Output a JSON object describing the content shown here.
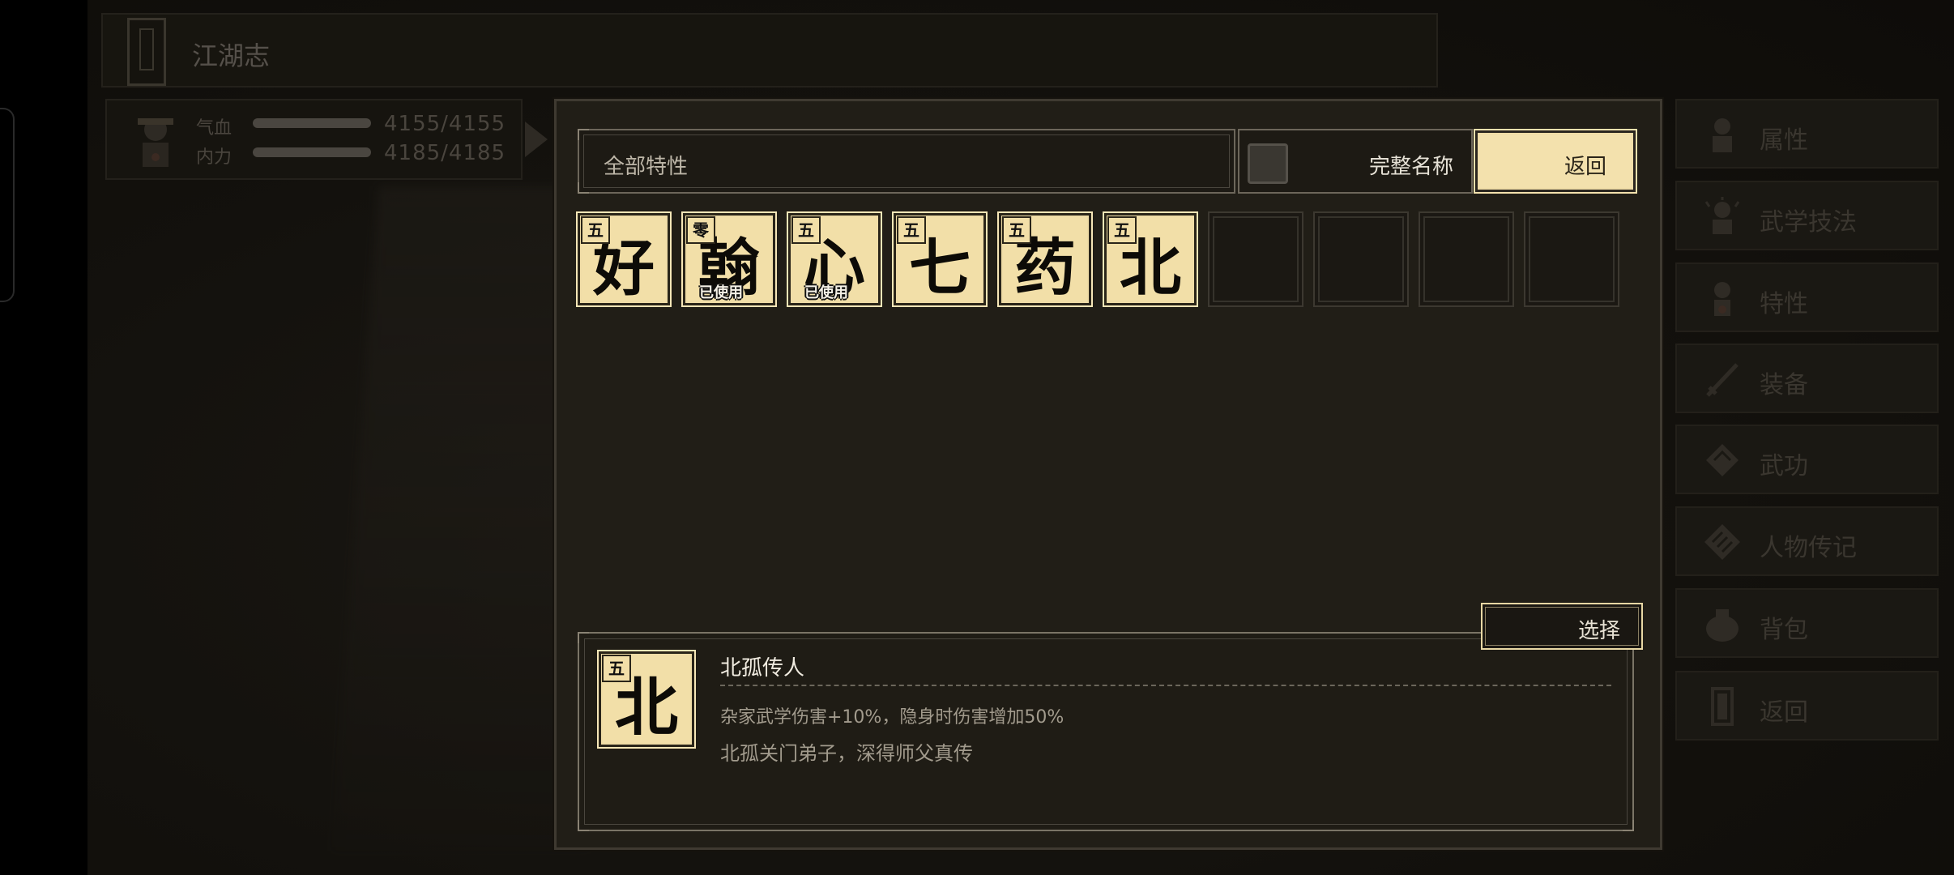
{
  "title_bar": {
    "title": "江湖志"
  },
  "player_status": {
    "hp_label": "气血",
    "hp_value": "4155/4155",
    "mp_label": "内力",
    "mp_value": "4185/4185"
  },
  "right_menu": {
    "items": [
      {
        "label": "属性",
        "icon": "person-icon"
      },
      {
        "label": "武学技法",
        "icon": "sparkle-person-icon"
      },
      {
        "label": "特性",
        "icon": "trait-person-icon"
      },
      {
        "label": "装备",
        "icon": "sword-icon"
      },
      {
        "label": "武功",
        "icon": "scroll-icon"
      },
      {
        "label": "人物传记",
        "icon": "book-icon"
      },
      {
        "label": "背包",
        "icon": "bag-icon"
      },
      {
        "label": "返回",
        "icon": "door-icon"
      }
    ]
  },
  "dialog": {
    "filter_label": "全部特性",
    "fullname_label": "完整名称",
    "fullname_checked": false,
    "return_label": "返回",
    "select_label": "选择",
    "cards": [
      {
        "tier": "五",
        "glyph": "好",
        "used": ""
      },
      {
        "tier": "零",
        "glyph": "翰",
        "used": "已使用"
      },
      {
        "tier": "五",
        "glyph": "心",
        "used": "已使用"
      },
      {
        "tier": "五",
        "glyph": "七",
        "used": ""
      },
      {
        "tier": "五",
        "glyph": "药",
        "used": ""
      },
      {
        "tier": "五",
        "glyph": "北",
        "used": ""
      }
    ],
    "empty_slots": 4,
    "detail": {
      "tier": "五",
      "glyph": "北",
      "name": "北孤传人",
      "effect": "杂家武学伤害+10%，隐身时伤害增加50%",
      "description": "北孤关门弟子，深得师父真传"
    }
  },
  "colors": {
    "card_fill": "#f2dfa8",
    "dialog_bg": "#211e17",
    "accent_border": "#e8d7a4"
  }
}
